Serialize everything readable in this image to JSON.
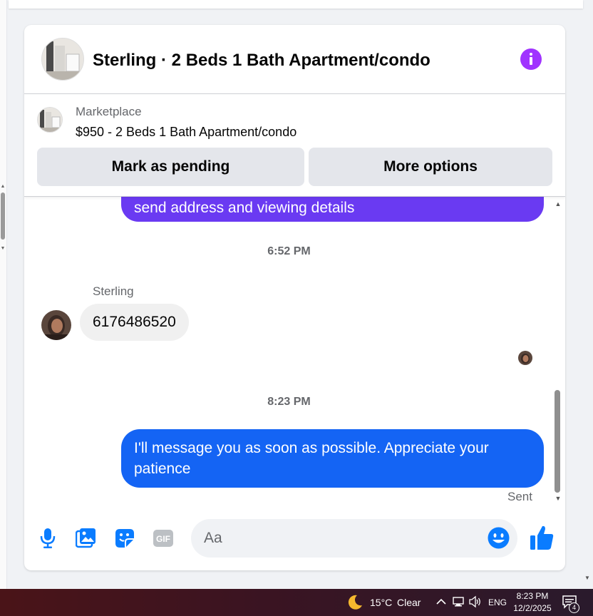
{
  "header": {
    "title": "Sterling · 2 Beds 1 Bath Apartment/condo"
  },
  "listing": {
    "source": "Marketplace",
    "title": "$950 - 2 Beds 1 Bath Apartment/condo",
    "pending_label": "Mark as pending",
    "more_label": "More options"
  },
  "messages": {
    "outgoing_partial": "send address and viewing details",
    "timestamp_1": "6:52 PM",
    "sender_name": "Sterling",
    "incoming_text": "6176486520",
    "timestamp_2": "8:23 PM",
    "outgoing_text": "I'll message you as soon as possible. Appreciate your patience",
    "status": "Sent"
  },
  "composer": {
    "placeholder": "Aa",
    "value": ""
  },
  "taskbar": {
    "temperature": "15°C",
    "condition": "Clear",
    "language": "ENG",
    "time": "8:23 PM",
    "date": "12/2/2025",
    "notification_count": "4"
  },
  "colors": {
    "accent_purple": "#a033ff",
    "outgoing_bubble": "#1464f4",
    "outgoing_bubble_earlier": "#6a3af2",
    "icon_blue": "#0a7cff"
  }
}
